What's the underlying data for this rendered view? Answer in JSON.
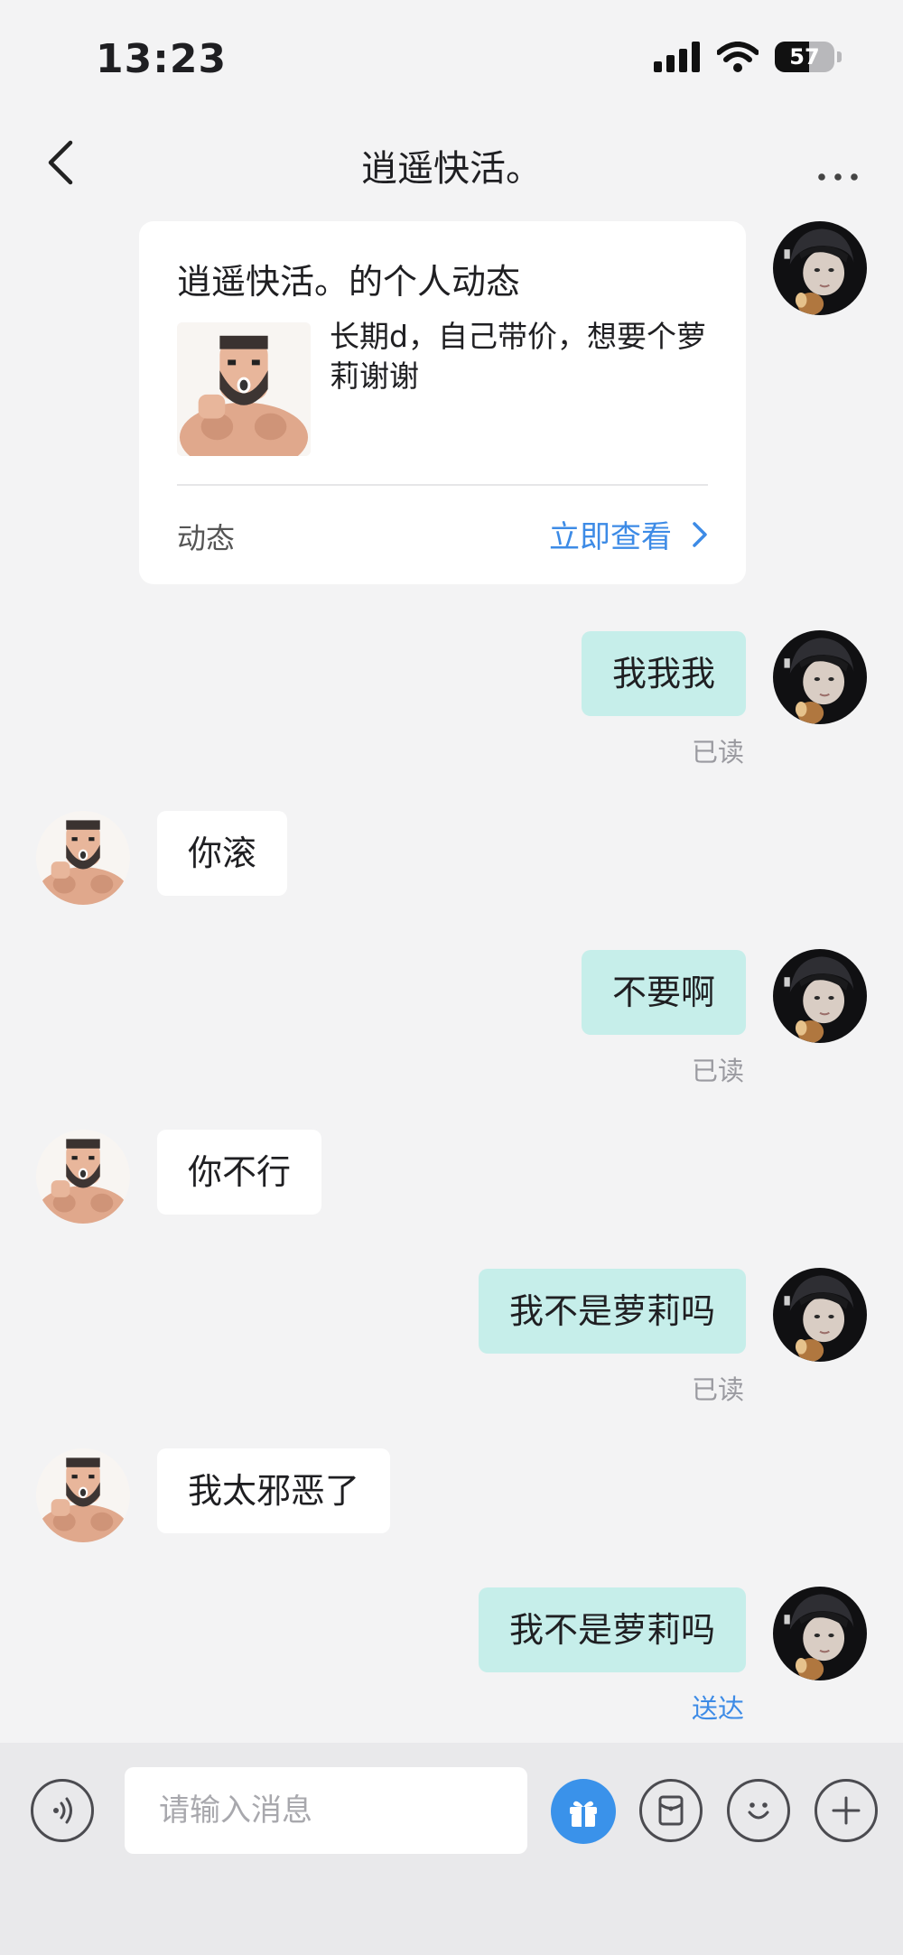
{
  "status_bar": {
    "time": "13:23",
    "battery": "57"
  },
  "header": {
    "title": "逍遥快活。"
  },
  "moment_card": {
    "title": "逍遥快活。的个人动态",
    "description": "长期d，自己带价，想要个萝莉谢谢",
    "footer_label": "动态",
    "link_label": "立即查看"
  },
  "messages": [
    {
      "sender": "me",
      "text": "我我我",
      "receipt": "已读"
    },
    {
      "sender": "other",
      "text": "你滚"
    },
    {
      "sender": "me",
      "text": "不要啊",
      "receipt": "已读"
    },
    {
      "sender": "other",
      "text": "你不行"
    },
    {
      "sender": "me",
      "text": "我不是萝莉吗",
      "receipt": "已读"
    },
    {
      "sender": "other",
      "text": "我太邪恶了"
    },
    {
      "sender": "me",
      "text": "我不是萝莉吗",
      "receipt": "送达"
    }
  ],
  "composer": {
    "placeholder": "请输入消息"
  },
  "colors": {
    "my_bubble": "#c6eeea",
    "link": "#3d8be6",
    "background": "#f3f3f4"
  }
}
